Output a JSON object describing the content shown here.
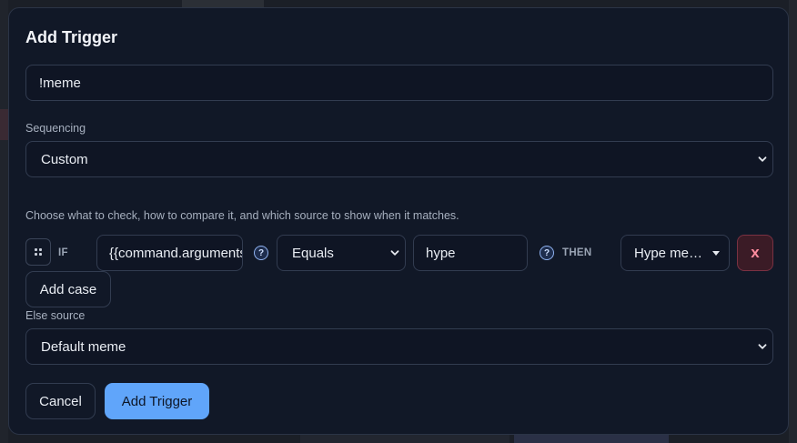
{
  "modal": {
    "title": "Add Trigger"
  },
  "trigger_name": {
    "value": "!meme"
  },
  "sequencing": {
    "label": "Sequencing",
    "selected": "Custom"
  },
  "conditions": {
    "help_text": "Choose what to check, how to compare it, and which source to show when it matches.",
    "if_keyword": "IF",
    "then_keyword": "THEN",
    "help_icon_glyph": "?",
    "rows": [
      {
        "check_value": "{{command.arguments}}",
        "operator": "Equals",
        "match_value": "hype",
        "source": "Hype me…",
        "remove_label": "x"
      }
    ],
    "add_case_label": "Add case"
  },
  "else_source": {
    "label": "Else source",
    "selected": "Default meme"
  },
  "actions": {
    "cancel_label": "Cancel",
    "submit_label": "Add Trigger"
  },
  "colors": {
    "modal_bg": "#111827",
    "accent": "#60a5fa",
    "danger": "#ff8d9f"
  },
  "icons": {
    "drag": "drag-handle-icon",
    "help": "help-circle-icon",
    "dropdown": "chevron-down-icon"
  }
}
